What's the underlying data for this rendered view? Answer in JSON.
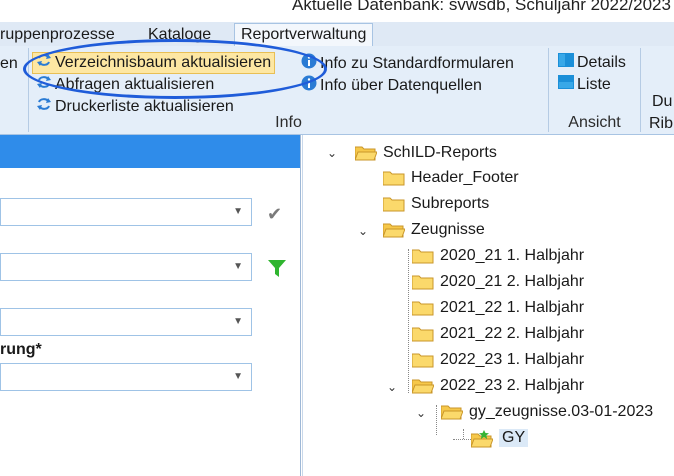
{
  "app": {
    "database_status": "Aktuelle Datenbank: svwsdb, Schuljahr 2022/2023"
  },
  "tabs": [
    {
      "label": "ruppenprozesse"
    },
    {
      "label": "Kataloge"
    },
    {
      "label": "Reportverwaltung"
    }
  ],
  "ribbon": {
    "left_partial_label": "en",
    "info_group": {
      "label": "Info",
      "refresh_tree": "Verzeichnisbaum aktualisieren",
      "refresh_queries": "Abfragen aktualisieren",
      "refresh_printers": "Druckerliste aktualisieren",
      "info_standard_forms": "Info zu Standardformularen",
      "info_data_sources": "Info über Datenquellen"
    },
    "view_group": {
      "label": "Ansicht",
      "details": "Details",
      "list": "Liste"
    },
    "partial_group": {
      "line1": "Du",
      "line2": "Rib"
    }
  },
  "left_panel": {
    "field_label_partial": "rung*"
  },
  "tree": {
    "root": "SchILD-Reports",
    "header_footer": "Header_Footer",
    "subreports": "Subreports",
    "zeugnisse": "Zeugnisse",
    "t1": "2020_21 1. Halbjahr",
    "t2": "2020_21 2. Halbjahr",
    "t3": "2021_22 1. Halbjahr",
    "t4": "2021_22 2. Halbjahr",
    "t5": "2022_23 1. Halbjahr",
    "t6": "2022_23 2. Halbjahr",
    "subfolder": "gy_zeugnisse.03-01-2023",
    "leaf": "GY"
  },
  "colors": {
    "accent_blue": "#2f8cea",
    "highlight_ellipse": "#1f5cd9",
    "ribbon_bg": "#e4eef9",
    "button_highlight": "#fde7a3"
  }
}
